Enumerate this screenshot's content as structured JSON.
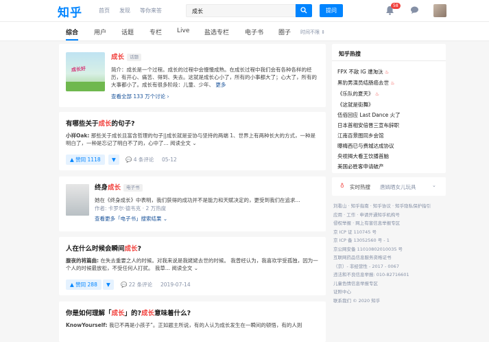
{
  "header": {
    "logo": "知乎",
    "nav": [
      "首页",
      "发现",
      "等你来答"
    ],
    "search_value": "成长",
    "ask_label": "提问",
    "notif_count": "58"
  },
  "tabs": [
    "综合",
    "用户",
    "话题",
    "专栏",
    "Live",
    "盐选专栏",
    "电子书",
    "圈子"
  ],
  "filter": "时间不限",
  "topic_card": {
    "title": "成长",
    "tag": "话题",
    "image_text": "成长好",
    "intro_label": "简介：",
    "intro": "成长是一个过程。成长的过程中会慢慢成熟。在成长过程中我们会有各种各样的经历，有开心、痛苦、得到、失去。这就是成长心小了，所有的小事都大了；心大了，所有的大事都小了。成长有很多阶段：儿童、少年、",
    "more": "更多",
    "view_all": "查看全部 133 万个讨论 ›"
  },
  "q1": {
    "title_pre": "有哪些关于",
    "title_hl": "成长",
    "title_post": "的句子?",
    "author": "小祥Oak:",
    "excerpt": "那些关于成长且富含哲理的句子||成长就是妥协与坚持的两端 1、世界上有两种长大的方式，一种是明白了，一种是忘记了明白不了的，心中了... 阅读全文 ⌄",
    "votes": "▲ 赞同 1118",
    "comments": "4 条评论",
    "date": "05-12"
  },
  "book_card": {
    "title_pre": "终身",
    "title_hl": "成长",
    "tag": "电子书",
    "excerpt": "她在《终身成长》中表明，我们获得的成功并不是能力和天赋决定的，更受到我们在追求...",
    "author": "作者: 卡罗尔·德韦克 · 2 万热度",
    "more": "查看更多「电子书」搜索结果 ⌄"
  },
  "q2": {
    "title_pre": "人在什么时候会瞬间",
    "title_hl": "成长",
    "title_post": "?",
    "author": "腹夜的将篇曲:",
    "excerpt": "在失去重要之人的时候。对我来说是我姥姥去世的时候。 我曾经认为，我喜欢学受孤独，因为一个人的时候最放松，不受任何人打扰。 我草... 阅读全文 ⌄",
    "votes": "▲ 赞同 288",
    "comments": "22 条评论",
    "date": "2019-07-14"
  },
  "q3": {
    "title_pre": "你是如何理解「",
    "title_hl": "成长",
    "title_mid": "」的?",
    "title_hl2": "成长",
    "title_post": "意味着什么?",
    "author": "KnowYourself:",
    "excerpt": "我已不再是小孩子”。正如题主所说，有的人认为成长发生在一瞬间的顿悟，有的人则"
  },
  "hot": {
    "title": "知乎热搜",
    "items": [
      {
        "text": "FPX 不敌 IG 遭淘汰",
        "fire": true
      },
      {
        "text": "黑豹男演员结肠癌去世",
        "fire": true
      },
      {
        "text": "《乐队的夏天》",
        "fire": true
      },
      {
        "text": "《这就是街舞》",
        "fire": false
      },
      {
        "text": "伍佰回应 Last Dance 火了",
        "fire": false
      },
      {
        "text": "日本首相安倍晋三宣布辞职",
        "fire": false
      },
      {
        "text": "江南百景图同乡会馆",
        "fire": false
      },
      {
        "text": "曝梅西已与费城达成协议",
        "fire": false
      },
      {
        "text": "央视揭大看王饮播首脑",
        "fire": false
      },
      {
        "text": "美国必胜客申请破产",
        "fire": false
      }
    ]
  },
  "live": {
    "label": "实时热搜",
    "text": "唐嫣晒女儿玩具"
  },
  "footer": [
    "刘看山 · 知乎指南 · 知乎协议 · 知乎隐私保护指引",
    "应用 · 工作 · 申请开通知乎机构号",
    "侵权举报 · 网上有害信息举报专区",
    "京 ICP 证 110745 号",
    "京 ICP 备 13052560 号 - 1",
    "京公网安备 11010802010035 号",
    "互联网药品信息服务资格证书",
    "（京）- 非经营性 - 2017 - 0067",
    "违法和不良信息举报: 010-82716601",
    "儿童色情信息举报专区",
    "证照中心",
    "联系我们 © 2020 知乎"
  ]
}
